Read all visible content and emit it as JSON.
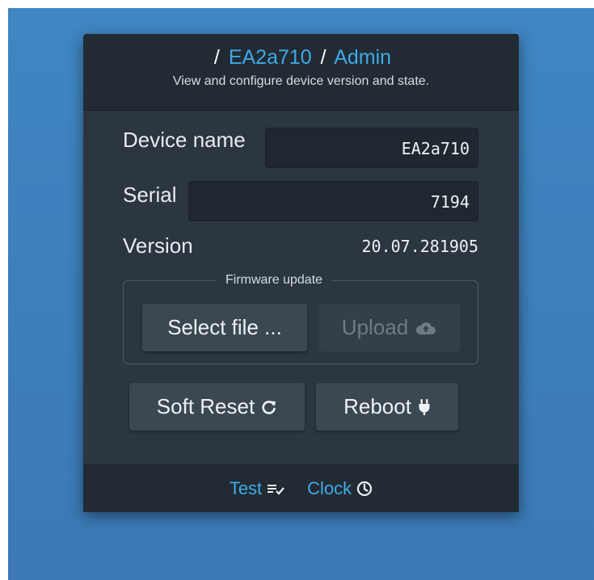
{
  "breadcrumb": {
    "separator": "/",
    "device": "EA2a710",
    "page": "Admin"
  },
  "subtitle": "View and configure device version and state.",
  "fields": {
    "device_name": {
      "label": "Device name",
      "value": "EA2a710"
    },
    "serial": {
      "label": "Serial",
      "value": "7194"
    },
    "version": {
      "label": "Version",
      "value": "20.07.281905"
    }
  },
  "firmware": {
    "legend": "Firmware update",
    "select_label": "Select file ...",
    "upload_label": "Upload"
  },
  "actions": {
    "soft_reset_label": "Soft Reset",
    "reboot_label": "Reboot"
  },
  "footer": {
    "test_label": "Test",
    "clock_label": "Clock"
  },
  "icons": {
    "upload": "cloud-upload-icon",
    "soft_reset": "refresh-icon",
    "reboot": "plug-icon",
    "test": "checklist-icon",
    "clock": "clock-icon"
  },
  "colors": {
    "accent": "#3fa9e8",
    "panel": "#2b3640",
    "header": "#222b33",
    "background": "#3f86c2"
  }
}
